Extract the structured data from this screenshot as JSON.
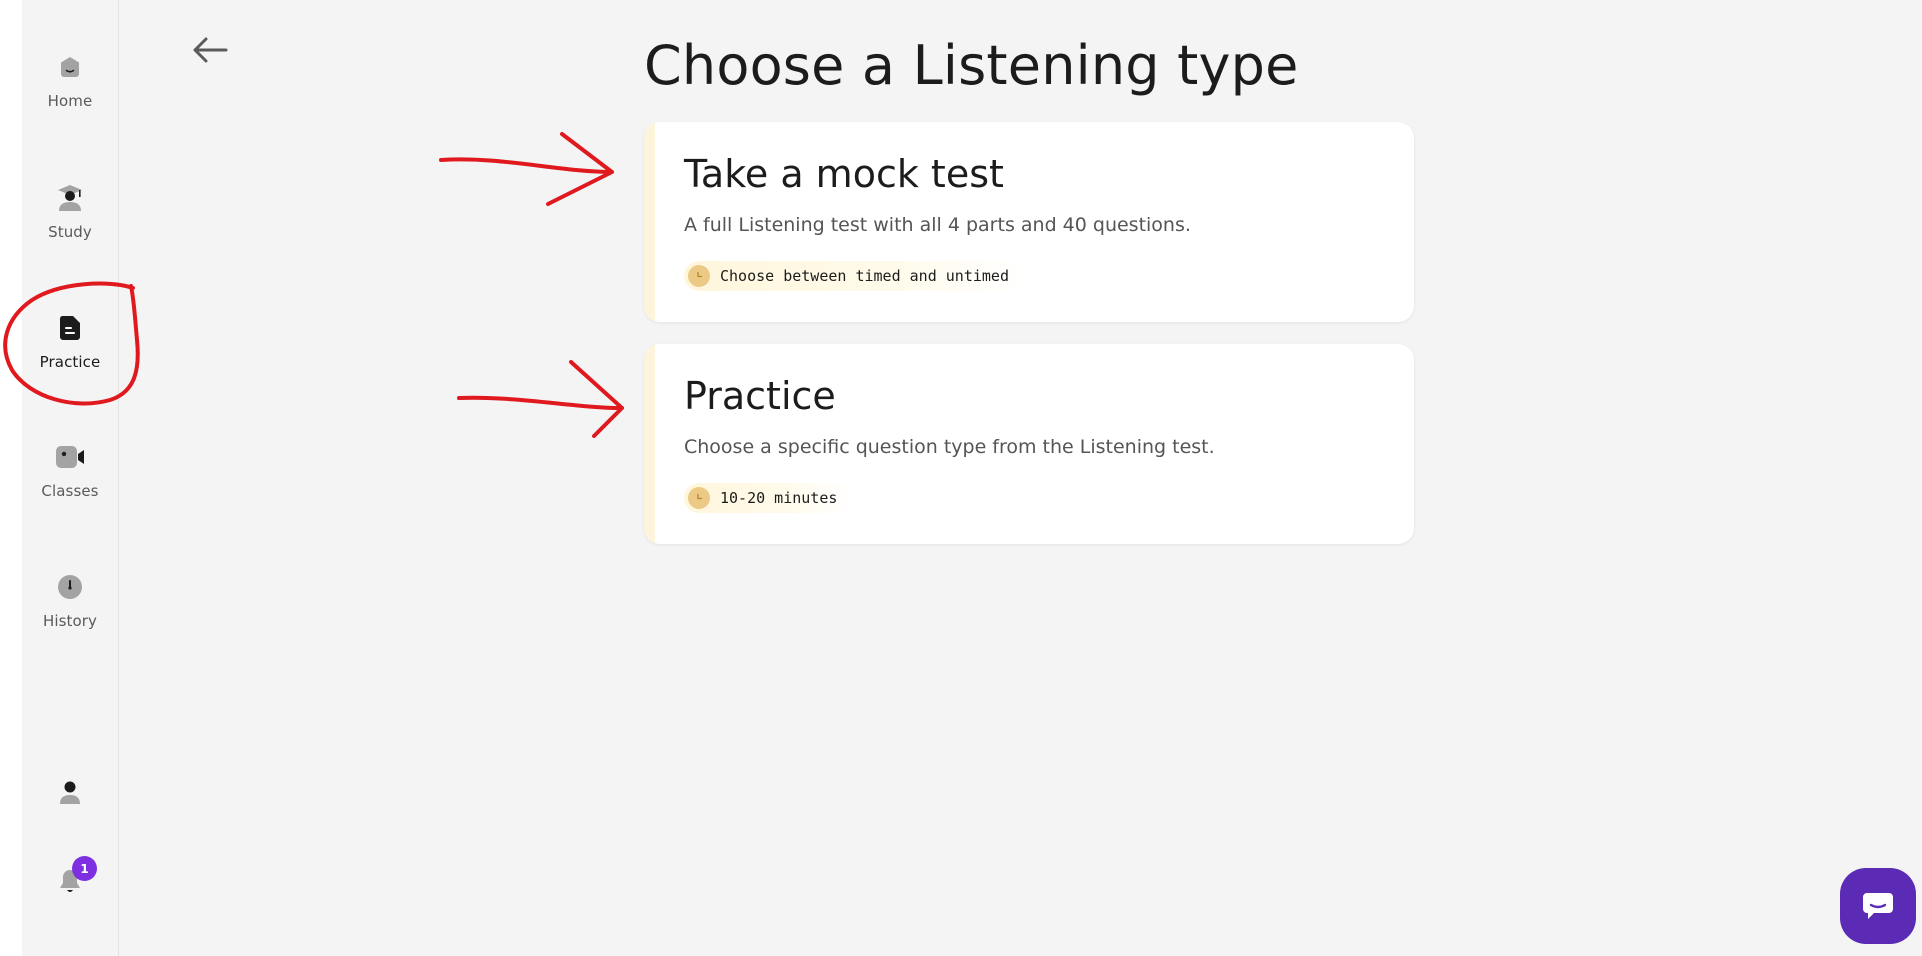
{
  "sidebar": {
    "items": [
      {
        "label": "Home",
        "icon": "home-icon",
        "active": false
      },
      {
        "label": "Study",
        "icon": "graduate-icon",
        "active": false
      },
      {
        "label": "Practice",
        "icon": "document-icon",
        "active": true
      },
      {
        "label": "Classes",
        "icon": "video-camera-icon",
        "active": false
      },
      {
        "label": "History",
        "icon": "clock-icon",
        "active": false
      }
    ],
    "bottom": {
      "profile_icon": "user-icon",
      "notification_icon": "bell-icon",
      "notification_count": "1"
    }
  },
  "header": {
    "back_icon": "arrow-left-icon",
    "title": "Choose a Listening type"
  },
  "options": [
    {
      "title": "Take a mock test",
      "description": "A full Listening test with all 4 parts and 40 questions.",
      "tag": "Choose between timed and untimed",
      "tag_icon": "clock-icon"
    },
    {
      "title": "Practice",
      "description": "Choose a specific question type from the Listening test.",
      "tag": "10-20 minutes",
      "tag_icon": "clock-icon"
    }
  ],
  "chat": {
    "icon": "chat-bubble-icon"
  },
  "colors": {
    "accent_badge": "#7e30e1",
    "chat_button": "#5c2bb5",
    "tag_clock": "#ecc985",
    "annotation_red": "#e0191f"
  }
}
